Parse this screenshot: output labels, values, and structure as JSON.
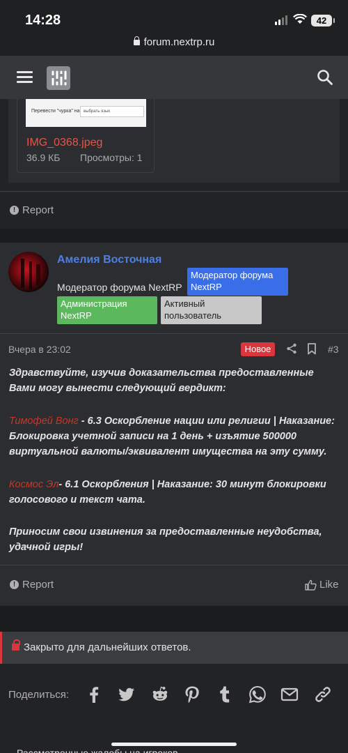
{
  "status_bar": {
    "time": "14:28",
    "battery": "42",
    "url": "forum.nextrp.ru"
  },
  "attachment": {
    "thumb_label": "Перевести \"чурка\" на",
    "thumb_select": "выбрать язык",
    "file_name": "IMG_0368.jpeg",
    "file_size": "36.9 КБ",
    "views": "Просмотры: 1"
  },
  "post1": {
    "report_label": "Report"
  },
  "post2": {
    "username": "Амелия Восточная",
    "user_title": "Модератор форума NextRP",
    "badges": [
      "Модератор форума NextRP",
      "Администрация NextRP",
      "Активный пользователь"
    ],
    "date": "Вчера в 23:02",
    "new_label": "Новое",
    "post_number": "#3",
    "message": {
      "p1": "Здравствуйте, изучив доказательства предоставленные Вами могу вынести следующий вердикт:",
      "p2_name": "Тимофей Вонг",
      "p2_text": " - 6.3 Оскорбление нации или религии | Наказание: Блокировка учетной записи на 1 день + изъятие 500000 виртуальной валюты/эквивалент имущества на эту сумму.",
      "p3_name": "Космос Эл",
      "p3_text": "- 6.1 Оскорбления | Наказание: 30 минут блокировки голосового и текст чата.",
      "p4": "Приносим свои извинения за предоставленные неудобства, удачной игры!"
    },
    "report_label": "Report",
    "like_label": "Like"
  },
  "thread_closed": "Закрыто для дальнейших ответов.",
  "share": {
    "label": "Поделиться:",
    "icons": [
      "facebook-icon",
      "twitter-icon",
      "reddit-icon",
      "pinterest-icon",
      "tumblr-icon",
      "whatsapp-icon",
      "email-icon",
      "link-icon"
    ]
  },
  "bottom_text": "Рассмотренные жалобы на игроков",
  "colors": {
    "accent_blue": "#4f7fe0",
    "new_red": "#d9363e",
    "admin_green": "#5cb85c",
    "link_red": "#e0584c"
  }
}
